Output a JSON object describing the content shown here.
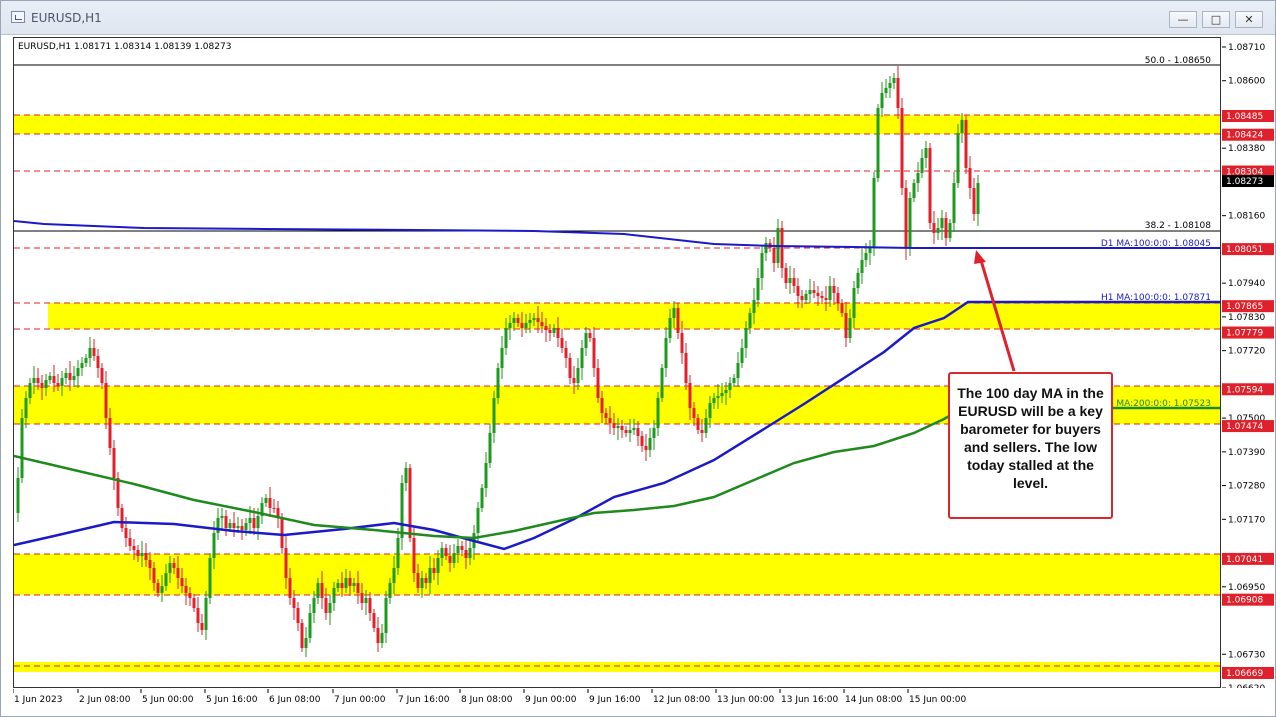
{
  "window": {
    "title": "EURUSD,H1",
    "minimize": "—",
    "maximize": "□",
    "close": "✕"
  },
  "chart": {
    "info": "EURUSD,H1  1.08171 1.08314 1.08139 1.08273",
    "colors": {
      "zone": "#ffff00",
      "red_line": "#e0202b",
      "ma100_daily": "#1a1ac8",
      "ma100_hourly": "#1a1ac8",
      "ma200_hourly": "#1e8a1e",
      "bull": "#1e9a1e",
      "bear": "#e0202b"
    },
    "price_labels": [
      "1.08710",
      "1.08600",
      "1.08380",
      "1.08160",
      "1.07940",
      "1.07830",
      "1.07720",
      "1.07500",
      "1.07390",
      "1.07280",
      "1.07170",
      "1.06950",
      "1.06730",
      "1.06620"
    ],
    "tagged_prices": [
      {
        "text": "1.08485",
        "color": "#e0202b"
      },
      {
        "text": "1.08424",
        "color": "#e0202b"
      },
      {
        "text": "1.08304",
        "color": "#e0202b"
      },
      {
        "text": "1.08273",
        "color": "#000000"
      },
      {
        "text": "1.08051",
        "color": "#e0202b"
      },
      {
        "text": "1.07865",
        "color": "#e0202b"
      },
      {
        "text": "1.07779",
        "color": "#e0202b"
      },
      {
        "text": "1.07594",
        "color": "#e0202b"
      },
      {
        "text": "1.07474",
        "color": "#e0202b"
      },
      {
        "text": "1.07041",
        "color": "#e0202b"
      },
      {
        "text": "1.06908",
        "color": "#e0202b"
      },
      {
        "text": "1.06669",
        "color": "#e0202b"
      }
    ],
    "time_labels": [
      "1 Jun 2023",
      "2 Jun 08:00",
      "5 Jun 00:00",
      "5 Jun 16:00",
      "6 Jun 08:00",
      "7 Jun 00:00",
      "7 Jun 16:00",
      "8 Jun 08:00",
      "9 Jun 00:00",
      "9 Jun 16:00",
      "12 Jun 08:00",
      "13 Jun 00:00",
      "13 Jun 16:00",
      "14 Jun 08:00",
      "15 Jun 00:00"
    ],
    "fib_50": "50.0 - 1.08650",
    "fib_382": "38.2 - 1.08108",
    "ma_d1_100": "D1 MA:100:0:0: 1.08045",
    "ma_h1_100": "H1 MA:100:0:0: 1.07871",
    "ma_h1_200": "H1 MA:200:0:0: 1.07523",
    "callout": "The 100 day MA in the EURUSD will be a key barometer for buyers and sellers. The low today stalled at the level."
  }
}
